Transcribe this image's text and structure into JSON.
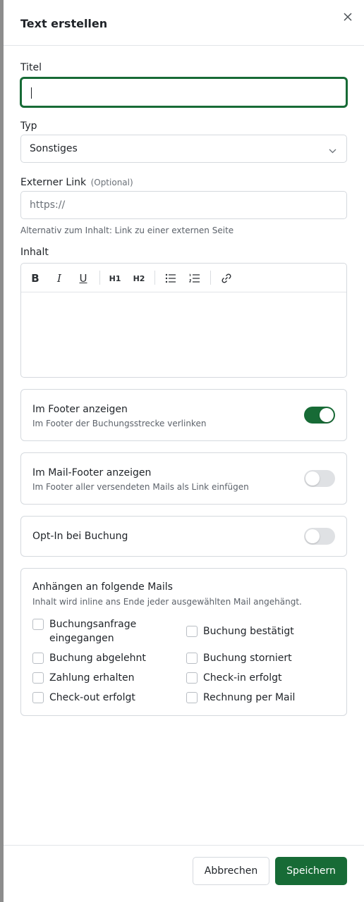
{
  "dialog": {
    "title": "Text erstellen"
  },
  "form": {
    "title_label": "Titel",
    "title_value": "",
    "type_label": "Typ",
    "type_value": "Sonstiges",
    "link_label": "Externer Link",
    "link_optional": "(Optional)",
    "link_placeholder": "https://",
    "link_helper": "Alternativ zum Inhalt: Link zu einer externen Seite",
    "content_label": "Inhalt",
    "toolbar": {
      "bold": "B",
      "italic": "I",
      "underline": "U",
      "h1": "H1",
      "h2": "H2"
    }
  },
  "settings": {
    "footer": {
      "title": "Im Footer anzeigen",
      "subtitle": "Im Footer der Buchungsstrecke verlinken",
      "enabled": true
    },
    "mail_footer": {
      "title": "Im Mail-Footer anzeigen",
      "subtitle": "Im Footer aller versendeten Mails als Link einfügen",
      "enabled": false
    },
    "opt_in": {
      "title": "Opt-In bei Buchung",
      "enabled": false
    }
  },
  "attach": {
    "title": "Anhängen an folgende Mails",
    "subtitle": "Inhalt wird inline ans Ende jeder ausgewählten Mail angehängt.",
    "options": [
      "Buchungsanfrage eingegangen",
      "Buchung bestätigt",
      "Buchung abgelehnt",
      "Buchung storniert",
      "Zahlung erhalten",
      "Check-in erfolgt",
      "Check-out erfolgt",
      "Rechnung per Mail"
    ]
  },
  "footer": {
    "cancel_label": "Abbrechen",
    "save_label": "Speichern"
  },
  "colors": {
    "accent": "#176b36",
    "border": "#d5d9de",
    "toggle_off": "#dfe1e4"
  }
}
